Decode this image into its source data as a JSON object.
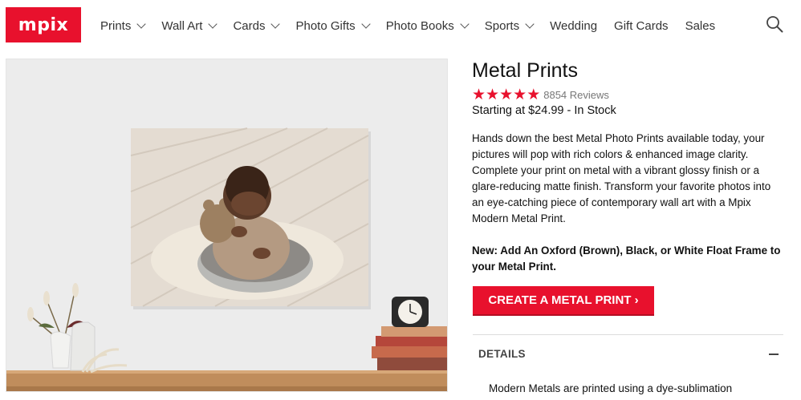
{
  "header": {
    "logo_text": "mpix",
    "nav": [
      {
        "label": "Prints",
        "has_dropdown": true
      },
      {
        "label": "Wall Art",
        "has_dropdown": true
      },
      {
        "label": "Cards",
        "has_dropdown": true
      },
      {
        "label": "Photo Gifts",
        "has_dropdown": true
      },
      {
        "label": "Photo Books",
        "has_dropdown": true
      },
      {
        "label": "Sports",
        "has_dropdown": true
      },
      {
        "label": "Wedding",
        "has_dropdown": false
      },
      {
        "label": "Gift Cards",
        "has_dropdown": false
      },
      {
        "label": "Sales",
        "has_dropdown": false
      }
    ],
    "search_icon": "search-icon"
  },
  "product": {
    "title": "Metal Prints",
    "rating_stars": 5,
    "reviews": "8854 Reviews",
    "price_line": "Starting at $24.99 - In Stock",
    "description": "Hands down the best Metal Photo Prints available today, your pictures will pop with rich colors & enhanced image clarity. Complete your print on metal with a vibrant glossy finish or a glare-reducing matte finish. Transform your favorite photos into an eye-catching piece of contemporary wall art with a Mpix Modern Metal Print.",
    "new_note": "New: Add An Oxford (Brown), Black, or White Float Frame to your Metal Print.",
    "cta_label": "CREATE A METAL PRINT ›",
    "details_label": "DETAILS",
    "details_text": "Modern Metals are printed using a dye-sublimation"
  },
  "colors": {
    "brand_red": "#e8112d",
    "star": "#e8112d"
  }
}
